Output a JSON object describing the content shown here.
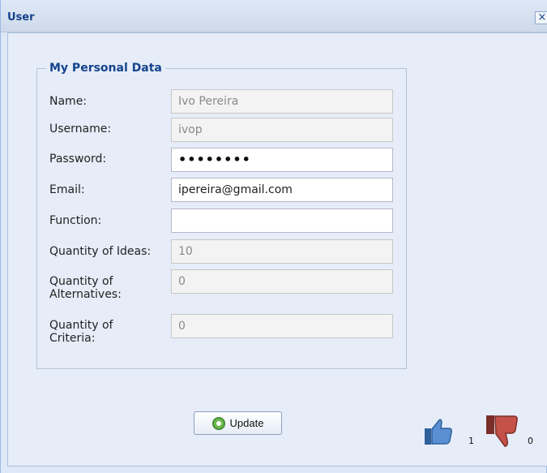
{
  "window": {
    "title": "User",
    "close_icon": "close-icon"
  },
  "personal_data": {
    "legend": "My Personal Data",
    "fields": [
      {
        "label": "Name:",
        "value": "Ivo Pereira",
        "disabled": true
      },
      {
        "label": "Username:",
        "value": "ivop",
        "disabled": true
      },
      {
        "label": "Password:",
        "value": "••••••••",
        "disabled": false
      },
      {
        "label": "Email:",
        "value": "ipereira@gmail.com",
        "disabled": false
      },
      {
        "label": "Function:",
        "value": "",
        "disabled": false
      },
      {
        "label": "Quantity of Ideas:",
        "value": "10",
        "disabled": true
      },
      {
        "label": "Quantity of Alternatives:",
        "value": "0",
        "disabled": true
      },
      {
        "label": "Quantity of Criteria:",
        "value": "0",
        "disabled": true
      }
    ]
  },
  "actions": {
    "update_label": "Update",
    "update_icon": "gear-icon"
  },
  "votes": {
    "likes": "1",
    "dislikes": "0",
    "like_icon": "thumbs-up-icon",
    "dislike_icon": "thumbs-down-icon"
  },
  "colors": {
    "title": "#15428b",
    "panel": "#dfe8f6",
    "like": "#4f7fbd",
    "dislike": "#9b4239"
  }
}
